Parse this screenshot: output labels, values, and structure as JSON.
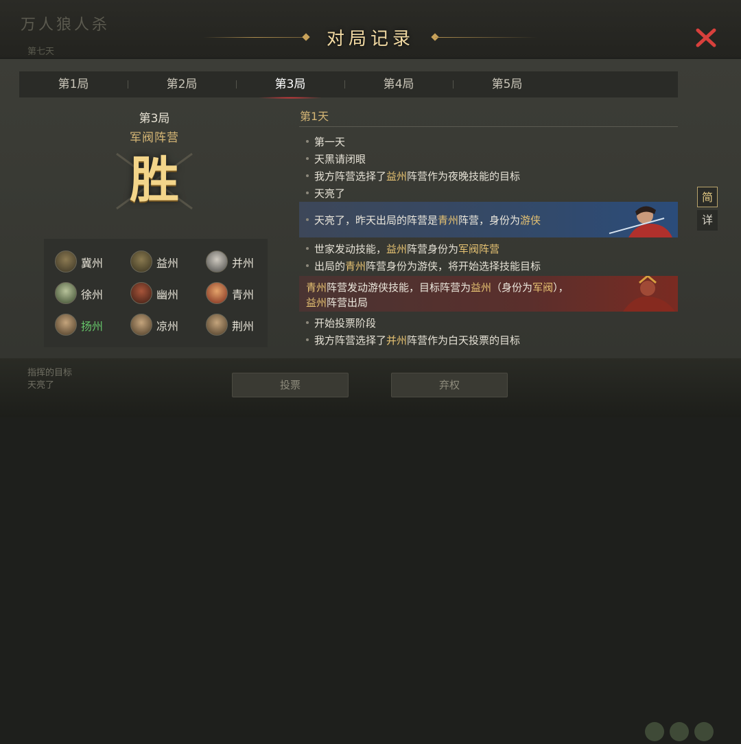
{
  "background": {
    "ghost_title": "万人狼人杀",
    "ghost_sub": "第七天",
    "ghost_lines": [
      "指挥的目标",
      "天亮了"
    ],
    "buttons": [
      "投票",
      "弃权"
    ]
  },
  "header": {
    "title": "对局记录"
  },
  "tabs": [
    {
      "label": "第1局",
      "active": false
    },
    {
      "label": "第2局",
      "active": false
    },
    {
      "label": "第3局",
      "active": true
    },
    {
      "label": "第4局",
      "active": false
    },
    {
      "label": "第5局",
      "active": false
    }
  ],
  "summary": {
    "round": "第3局",
    "camp": "军阀阵营",
    "result": "胜"
  },
  "players": [
    {
      "name": "冀州",
      "color": "#e6e2d6"
    },
    {
      "name": "益州",
      "color": "#e6e2d6"
    },
    {
      "name": "并州",
      "color": "#e6e2d6"
    },
    {
      "name": "徐州",
      "color": "#e6e2d6"
    },
    {
      "name": "幽州",
      "color": "#e6e2d6"
    },
    {
      "name": "青州",
      "color": "#e6e2d6"
    },
    {
      "name": "扬州",
      "color": "#66c66a"
    },
    {
      "name": "凉州",
      "color": "#e6e2d6"
    },
    {
      "name": "荆州",
      "color": "#e6e2d6"
    }
  ],
  "log": {
    "day": "第1天",
    "lines": [
      {
        "p1": "第一天"
      },
      {
        "p1": "天黑请闭眼"
      },
      {
        "p1": "我方阵营选择了",
        "g1": "益州",
        "p2": "阵营作为夜晚技能的目标"
      },
      {
        "p1": "天亮了"
      }
    ],
    "highlight_blue": {
      "p1": "天亮了，昨天出局的阵营是",
      "g1": "青州",
      "p2": "阵营，身份为",
      "g2": "游侠"
    },
    "lines2": [
      {
        "p1": "世家发动技能，",
        "g1": "益州",
        "p2": "阵营身份为",
        "g2": "军阀阵营"
      },
      {
        "p1": "出局的",
        "g1": "青州",
        "p2": "阵营身份为游侠，将开始选择技能目标"
      }
    ],
    "highlight_red": {
      "g1": "青州",
      "p1": "阵营发动游侠技能，目标阵营为",
      "g2": "益州",
      "p2": "（身份为",
      "g3": "军阀",
      "p3": "），",
      "g4": "益州",
      "p4": "阵营出局"
    },
    "lines3": [
      {
        "p1": "开始投票阶段"
      },
      {
        "p1": "我方阵营选择了",
        "g1": "并州",
        "p2": "阵营作为白天投票的目标"
      }
    ]
  },
  "view_toggle": {
    "simple": "简",
    "detail": "详"
  },
  "colors": {
    "gold": "#e6c272",
    "accent_red": "#d8403c",
    "highlight_green": "#66c66a"
  }
}
